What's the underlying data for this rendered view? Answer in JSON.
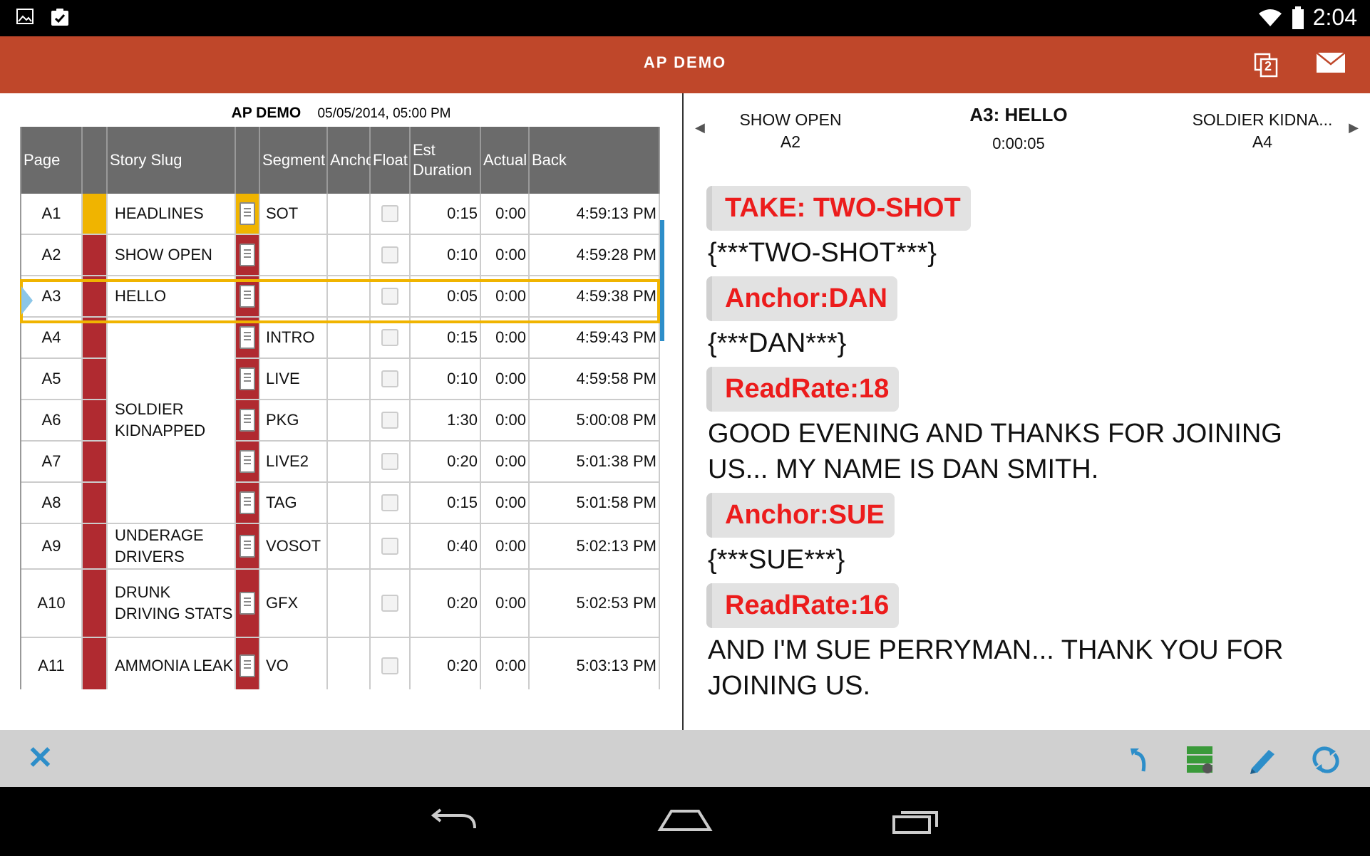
{
  "status_bar": {
    "time": "2:04"
  },
  "app_bar": {
    "title": "AP DEMO"
  },
  "rundown": {
    "name": "AP DEMO",
    "datetime": "05/05/2014, 05:00 PM",
    "columns": [
      "Page",
      "",
      "Story Slug",
      "",
      "Segment",
      "Anchor",
      "Float",
      "Est Duration",
      "Actual",
      "Back"
    ],
    "rows": [
      {
        "page": "A1",
        "slug": "HEADLINES",
        "segment": "SOT",
        "anchor": "",
        "est": "0:15",
        "actual": "0:00",
        "back": "4:59:13 PM",
        "status_color": "#f0b400"
      },
      {
        "page": "A2",
        "slug": "SHOW OPEN",
        "segment": "",
        "anchor": "",
        "est": "0:10",
        "actual": "0:00",
        "back": "4:59:28 PM",
        "status_color": "#b02a30"
      },
      {
        "page": "A3",
        "slug": "HELLO",
        "segment": "",
        "anchor": "",
        "est": "0:05",
        "actual": "0:00",
        "back": "4:59:38 PM",
        "status_color": "#b02a30"
      },
      {
        "page": "A4",
        "slug": "",
        "segment": "INTRO",
        "anchor": "",
        "est": "0:15",
        "actual": "0:00",
        "back": "4:59:43 PM",
        "status_color": "#b02a30"
      },
      {
        "page": "A5",
        "slug": "",
        "segment": "LIVE",
        "anchor": "",
        "est": "0:10",
        "actual": "0:00",
        "back": "4:59:58 PM",
        "status_color": "#b02a30"
      },
      {
        "page": "A6",
        "slug": "SOLDIER KIDNAPPED",
        "segment": "PKG",
        "anchor": "",
        "est": "1:30",
        "actual": "0:00",
        "back": "5:00:08 PM",
        "status_color": "#b02a30"
      },
      {
        "page": "A7",
        "slug": "",
        "segment": "LIVE2",
        "anchor": "",
        "est": "0:20",
        "actual": "0:00",
        "back": "5:01:38 PM",
        "status_color": "#b02a30"
      },
      {
        "page": "A8",
        "slug": "",
        "segment": "TAG",
        "anchor": "",
        "est": "0:15",
        "actual": "0:00",
        "back": "5:01:58 PM",
        "status_color": "#b02a30"
      },
      {
        "page": "A9",
        "slug": "UNDERAGE DRIVERS",
        "segment": "VOSOT",
        "anchor": "",
        "est": "0:40",
        "actual": "0:00",
        "back": "5:02:13 PM",
        "status_color": "#b02a30"
      },
      {
        "page": "A10",
        "slug": "DRUNK DRIVING STATS",
        "segment": "GFX",
        "anchor": "",
        "est": "0:20",
        "actual": "0:00",
        "back": "5:02:53 PM",
        "status_color": "#b02a30"
      },
      {
        "page": "A11",
        "slug": "AMMONIA LEAK",
        "segment": "VO",
        "anchor": "",
        "est": "0:20",
        "actual": "0:00",
        "back": "5:03:13 PM",
        "status_color": "#b02a30"
      }
    ],
    "selected_page": "A3"
  },
  "story_view": {
    "prev": {
      "title": "SHOW OPEN",
      "page": "A2"
    },
    "current": {
      "title": "A3: HELLO",
      "duration": "0:00:05"
    },
    "next": {
      "title": "SOLDIER KIDNA...",
      "page": "A4"
    },
    "script": [
      {
        "type": "cue",
        "text": "TAKE: TWO-SHOT"
      },
      {
        "type": "text",
        "text": "{***TWO-SHOT***}"
      },
      {
        "type": "cue",
        "text": "Anchor:DAN"
      },
      {
        "type": "text",
        "text": "{***DAN***}"
      },
      {
        "type": "cue",
        "text": "ReadRate:18"
      },
      {
        "type": "text",
        "text": "GOOD EVENING AND THANKS FOR JOINING US... MY NAME IS DAN SMITH."
      },
      {
        "type": "cue",
        "text": "Anchor:SUE"
      },
      {
        "type": "text",
        "text": "{***SUE***}"
      },
      {
        "type": "cue",
        "text": "ReadRate:16"
      },
      {
        "type": "text",
        "text": "AND I'M SUE PERRYMAN... THANK YOU FOR JOINING US."
      }
    ]
  },
  "icons": {
    "status_left": [
      "image-icon",
      "clipboard-check-icon"
    ],
    "status_right": [
      "wifi-icon",
      "battery-icon"
    ],
    "app_actions": [
      "copy-icon",
      "mail-icon"
    ],
    "toolbar_tools": [
      "undo-icon",
      "server-icon",
      "pencil-icon",
      "refresh-icon"
    ],
    "nav_buttons": [
      "back-icon",
      "home-icon",
      "recents-icon"
    ],
    "copy_badge": "2"
  },
  "colors": {
    "app_bar": "#bf472a",
    "accent_blue": "#2d8ec9",
    "cue_red": "#ec1c1c",
    "selected_outline": "#f0b400"
  }
}
